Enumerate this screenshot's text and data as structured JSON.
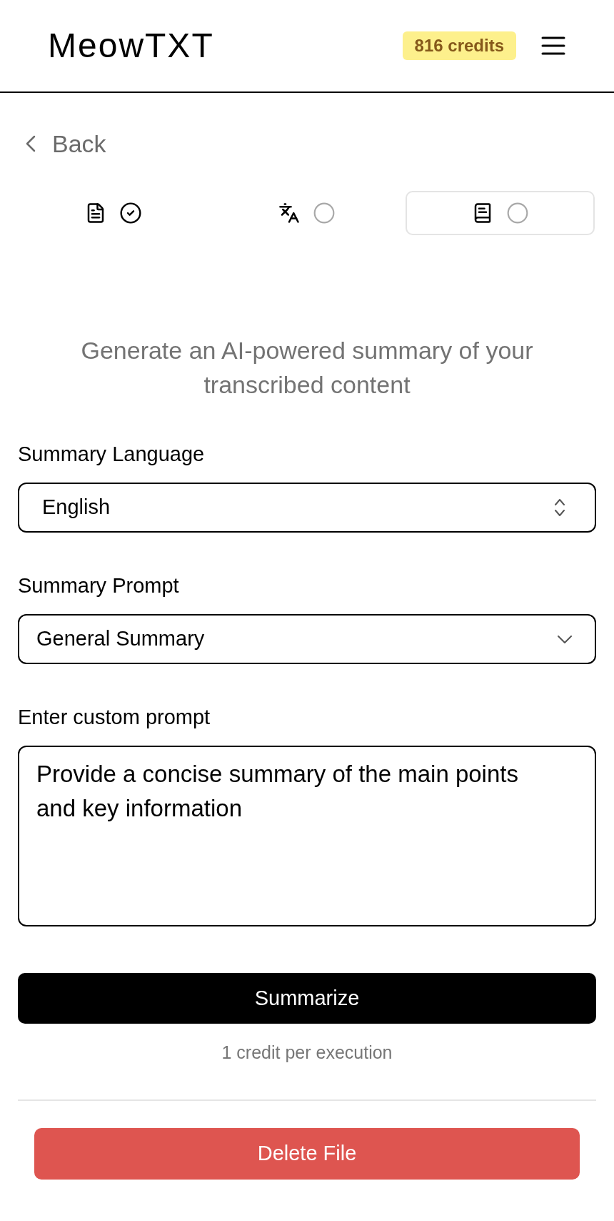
{
  "header": {
    "logo": "MeowTXT",
    "credits_badge": "816 credits"
  },
  "back_link": {
    "label": "Back"
  },
  "steps": [
    {
      "kind": "transcript",
      "done": true,
      "selected": false
    },
    {
      "kind": "translate",
      "done": false,
      "selected": false
    },
    {
      "kind": "summary",
      "done": false,
      "selected": true
    }
  ],
  "description": "Generate an AI-powered summary of your transcribed content",
  "form": {
    "fields": [
      {
        "kind": "select",
        "label": "Summary Language",
        "value": "English"
      },
      {
        "kind": "dropdown",
        "label": "Summary Prompt",
        "value": "General Summary"
      },
      {
        "kind": "textarea",
        "label": "Enter custom prompt",
        "value": "Provide a concise summary of the main points and key information"
      }
    ]
  },
  "summarize_button": "Summarize",
  "cost_note": "1 credit per execution",
  "delete_button": "Delete File"
}
